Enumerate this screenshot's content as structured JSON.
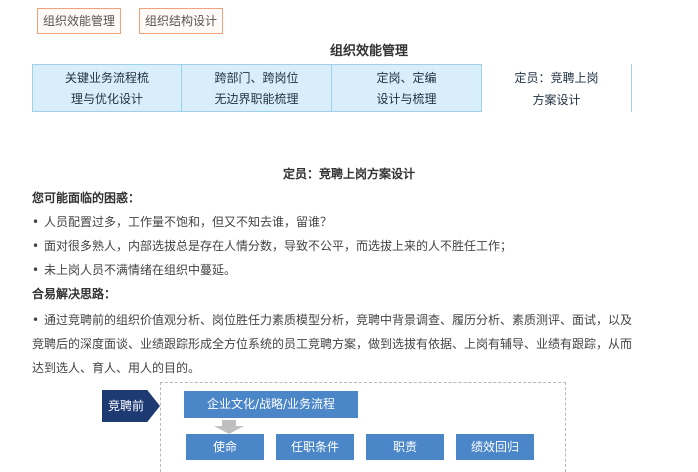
{
  "top_tags": [
    "组织效能管理",
    "组织结构设计"
  ],
  "nav_title": "组织效能管理",
  "tabs": [
    {
      "line1": "关键业务流程梳",
      "line2": "理与优化设计"
    },
    {
      "line1": "跨部门、跨岗位",
      "line2": "无边界职能梳理"
    },
    {
      "line1": "定岗、定编",
      "line2": "设计与梳理"
    },
    {
      "line1": "定员：竞聘上岗",
      "line2": "方案设计"
    }
  ],
  "content": {
    "title": "定员：竞聘上岗方案设计",
    "problems_heading": "您可能面临的困惑：",
    "problems": [
      "人员配置过多，工作量不饱和，但又不知去谁，留谁？",
      "面对很多熟人，内部选拔总是存在人情分数，导致不公平，而选拔上来的人不胜任工作；",
      "未上岗人员不满情绪在组织中蔓延。"
    ],
    "solution_heading": "合易解决思路：",
    "solution_text": "通过竞聘前的组织价值观分析、岗位胜任力素质模型分析，竞聘中背景调查、履历分析、素质测评、面试，以及竞聘后的深度面谈、业绩跟踪形成全方位系统的员工竞聘方案，做到选拔有依据、上岗有辅导、业绩有跟踪，从而达到选人、育人、用人的目的。"
  },
  "diagram": {
    "stage_label": "竞聘前",
    "top_box": "企业文化/战略/业务流程",
    "bottom_boxes": [
      "使命",
      "任职条件",
      "职责",
      "绩效回归"
    ]
  },
  "colors": {
    "tab_bg": "#d8eefa",
    "tab_border": "#9fd1ea",
    "tag_border": "#f2a27a",
    "diagram_box": "#4a86c8",
    "stage_label_bg": "#1e3a73"
  }
}
